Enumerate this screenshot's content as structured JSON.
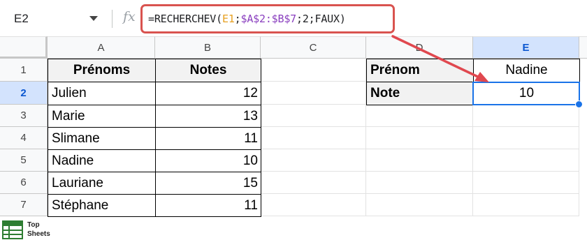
{
  "formula_bar": {
    "cell_reference": "E2",
    "fx_label": "fx",
    "formula": {
      "prefix": "=RECHERCHEV(",
      "arg1": "E1",
      "sep1": ";",
      "arg2": "$A$2:$B$7",
      "sep2": ";",
      "arg3": "2",
      "sep3": ";",
      "suffix": "FAUX)"
    }
  },
  "columns": [
    "A",
    "B",
    "C",
    "D",
    "E"
  ],
  "active_column": "E",
  "rows": [
    "1",
    "2",
    "3",
    "4",
    "5",
    "6",
    "7"
  ],
  "active_row": "2",
  "table": {
    "headers": [
      "Prénoms",
      "Notes"
    ],
    "rows": [
      [
        "Julien",
        "12"
      ],
      [
        "Marie",
        "13"
      ],
      [
        "Slimane",
        "11"
      ],
      [
        "Nadine",
        "10"
      ],
      [
        "Lauriane",
        "15"
      ],
      [
        "Stéphane",
        "11"
      ]
    ]
  },
  "lookup": {
    "label_prenom": "Prénom",
    "value_prenom": "Nadine",
    "label_note": "Note",
    "value_note": "10"
  },
  "colors": {
    "formula_highlight": "#d9534f",
    "arrow": "#e0484f",
    "selection": "#1a73e8",
    "ref_e1": "#e7a021",
    "ref_range": "#8a3fbf"
  },
  "logo": {
    "line1": "Top",
    "line2": "Sheets"
  }
}
